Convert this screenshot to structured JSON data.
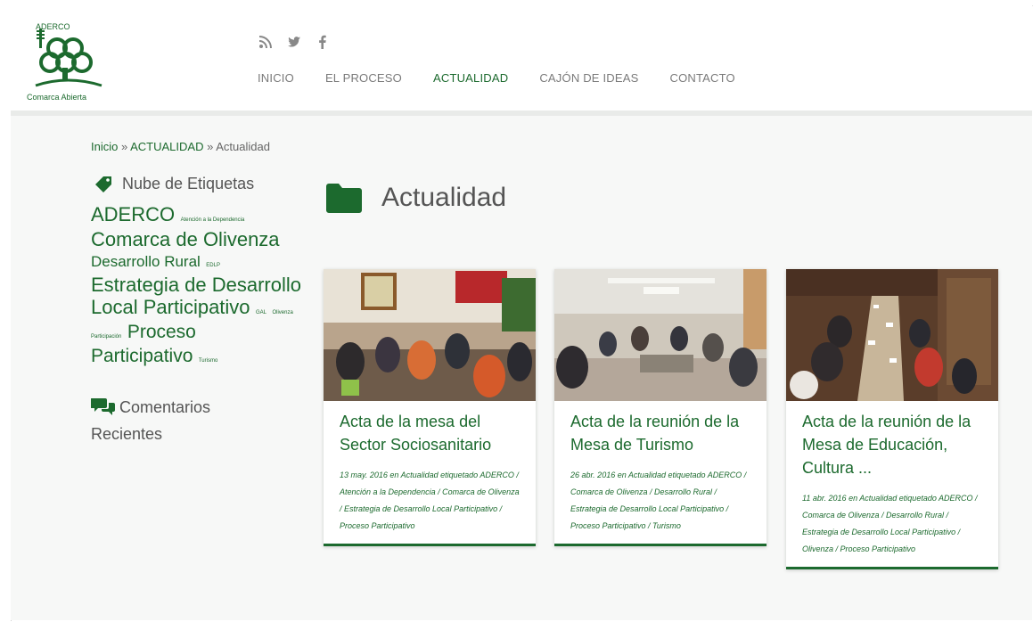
{
  "brand": {
    "logo_top": "ADERCO",
    "logo_bottom": "Comarca Abierta",
    "accent": "#1c6a2e"
  },
  "social": [
    {
      "icon": "rss-icon"
    },
    {
      "icon": "twitter-icon"
    },
    {
      "icon": "facebook-icon"
    }
  ],
  "nav": {
    "items": [
      {
        "label": "INICIO"
      },
      {
        "label": "EL PROCESO"
      },
      {
        "label": "ACTUALIDAD",
        "active": true
      },
      {
        "label": "CAJÓN DE IDEAS"
      },
      {
        "label": "CONTACTO"
      }
    ]
  },
  "breadcrumb": {
    "home": "Inicio",
    "sep1": " » ",
    "section": "ACTUALIDAD",
    "sep2": " » ",
    "current": "Actualidad"
  },
  "sidebar": {
    "tags_title": "Nube de Etiquetas",
    "tags": [
      {
        "label": "ADERCO",
        "size": "xl"
      },
      {
        "label": "Atención a la Dependencia",
        "size": "xs"
      },
      {
        "label": "Comarca de Olivenza",
        "size": "xl"
      },
      {
        "label": "Desarrollo Rural",
        "size": "md"
      },
      {
        "label": "EDLP",
        "size": "xs"
      },
      {
        "label": "Estrategia de Desarrollo Local Participativo",
        "size": "xl"
      },
      {
        "label": "GAL",
        "size": "xs"
      },
      {
        "label": "Olivenza",
        "size": "xs"
      },
      {
        "label": "Participación",
        "size": "xs"
      },
      {
        "label": "Proceso Participativo",
        "size": "lg"
      },
      {
        "label": "Turismo",
        "size": "xs"
      }
    ],
    "comments_title": "Comentarios Recientes"
  },
  "main": {
    "title": "Actualidad",
    "posts": [
      {
        "title": "Acta de la mesa del Sector Sociosanitario",
        "date": "13 may. 2016",
        "in_label": "en",
        "category": "Actualidad",
        "tagged_label": "etiquetado",
        "tags": "ADERCO / Atención a la Dependencia / Comarca de Olivenza / Estrategia de Desarrollo Local Participativo / Proceso Participativo"
      },
      {
        "title": "Acta de la reunión de la Mesa de Turismo",
        "date": "26 abr. 2016",
        "in_label": "en",
        "category": "Actualidad",
        "tagged_label": "etiquetado",
        "tags": "ADERCO / Comarca de Olivenza / Desarrollo Rural / Estrategia de Desarrollo Local Participativo / Proceso Participativo / Turismo"
      },
      {
        "title": "Acta de la reunión de la Mesa de Educación, Cultura ...",
        "date": "11 abr. 2016",
        "in_label": "en",
        "category": "Actualidad",
        "tagged_label": "etiquetado",
        "tags": "ADERCO / Comarca de Olivenza / Desarrollo Rural / Estrategia de Desarrollo Local Participativo / Olivenza / Proceso Participativo"
      }
    ]
  }
}
